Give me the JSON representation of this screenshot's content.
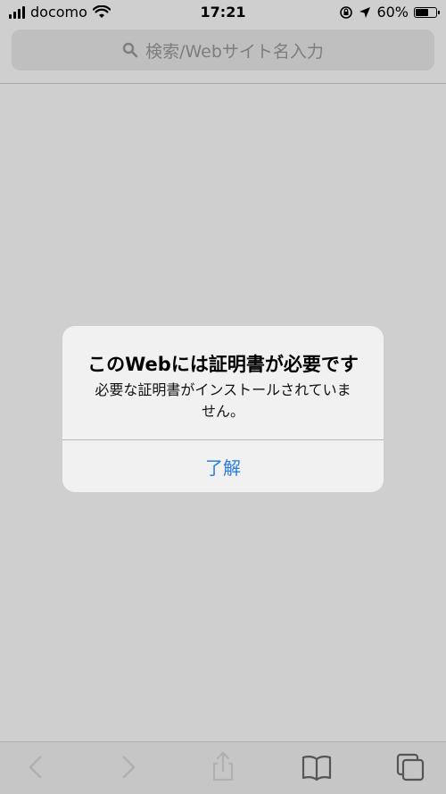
{
  "status_bar": {
    "carrier": "docomo",
    "time": "17:21",
    "battery_percent": "60%"
  },
  "address_bar": {
    "placeholder": "検索/Webサイト名入力"
  },
  "alert": {
    "title": "このWebには証明書が必要です",
    "message": "必要な証明書がインストールされていません。",
    "ok_label": "了解"
  },
  "toolbar": {
    "back_icon": "chevron-left-icon",
    "forward_icon": "chevron-right-icon",
    "share_icon": "share-icon",
    "bookmarks_icon": "book-icon",
    "tabs_icon": "tabs-icon"
  },
  "colors": {
    "accent": "#2a7de1",
    "background": "#cfcfcf",
    "alert_bg": "#f1f1f1"
  }
}
